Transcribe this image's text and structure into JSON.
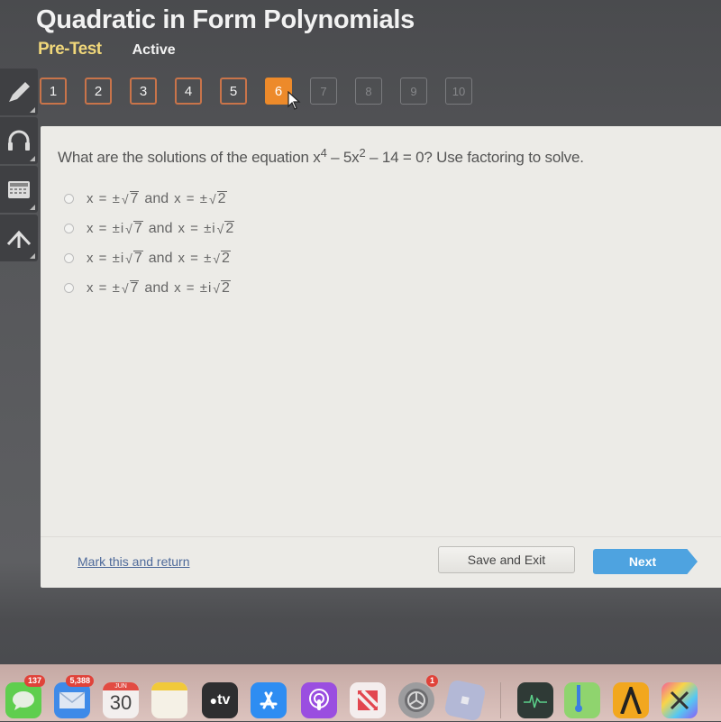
{
  "header": {
    "title": "Quadratic in Form Polynomials",
    "test_type": "Pre-Test",
    "status": "Active"
  },
  "tools": [
    {
      "name": "pencil-icon",
      "label": "pencil"
    },
    {
      "name": "headphones-icon",
      "label": "headphones"
    },
    {
      "name": "calculator-icon",
      "label": "calculator"
    },
    {
      "name": "reference-arrow-icon",
      "label": "reference"
    }
  ],
  "question_nav": {
    "current": 6,
    "items": [
      {
        "label": "1",
        "state": "answered"
      },
      {
        "label": "2",
        "state": "answered"
      },
      {
        "label": "3",
        "state": "answered"
      },
      {
        "label": "4",
        "state": "answered"
      },
      {
        "label": "5",
        "state": "answered"
      },
      {
        "label": "6",
        "state": "current"
      },
      {
        "label": "7",
        "state": "disabled"
      },
      {
        "label": "8",
        "state": "disabled"
      },
      {
        "label": "9",
        "state": "disabled"
      },
      {
        "label": "10",
        "state": "disabled"
      }
    ]
  },
  "question": {
    "prefix": "What are the solutions of the equation ",
    "eq_x": "x",
    "eq_exp1": "4",
    "eq_mid": " – 5x",
    "eq_exp2": "2",
    "suffix": " – 14 = 0? Use factoring to solve."
  },
  "options": [
    {
      "a_prefix": "x = ±",
      "a_rad": "7",
      "and": "and",
      "b_prefix": "x = ±",
      "b_rad": "2",
      "selected": false
    },
    {
      "a_prefix": "x = ±i",
      "a_rad": "7",
      "and": "and",
      "b_prefix": "x = ±i",
      "b_rad": "2",
      "selected": false
    },
    {
      "a_prefix": "x = ±i",
      "a_rad": "7",
      "and": "and",
      "b_prefix": "x = ±",
      "b_rad": "2",
      "selected": false
    },
    {
      "a_prefix": "x = ±",
      "a_rad": "7",
      "and": "and",
      "b_prefix": "x = ±i",
      "b_rad": "2",
      "selected": false
    }
  ],
  "footer": {
    "mark_label": "Mark this and return",
    "save_label": "Save and Exit",
    "next_label": "Next"
  },
  "dock": {
    "messages_badge": "137",
    "mail_badge": "5,388",
    "calendar_month": "JUN",
    "calendar_day": "30",
    "tv_label": "tv",
    "settings_badge": "1"
  },
  "colors": {
    "current_question": "#ed8a2a",
    "next_button": "#4ea3e0",
    "pretest": "#f0d77a",
    "link": "#4e6a9a"
  }
}
